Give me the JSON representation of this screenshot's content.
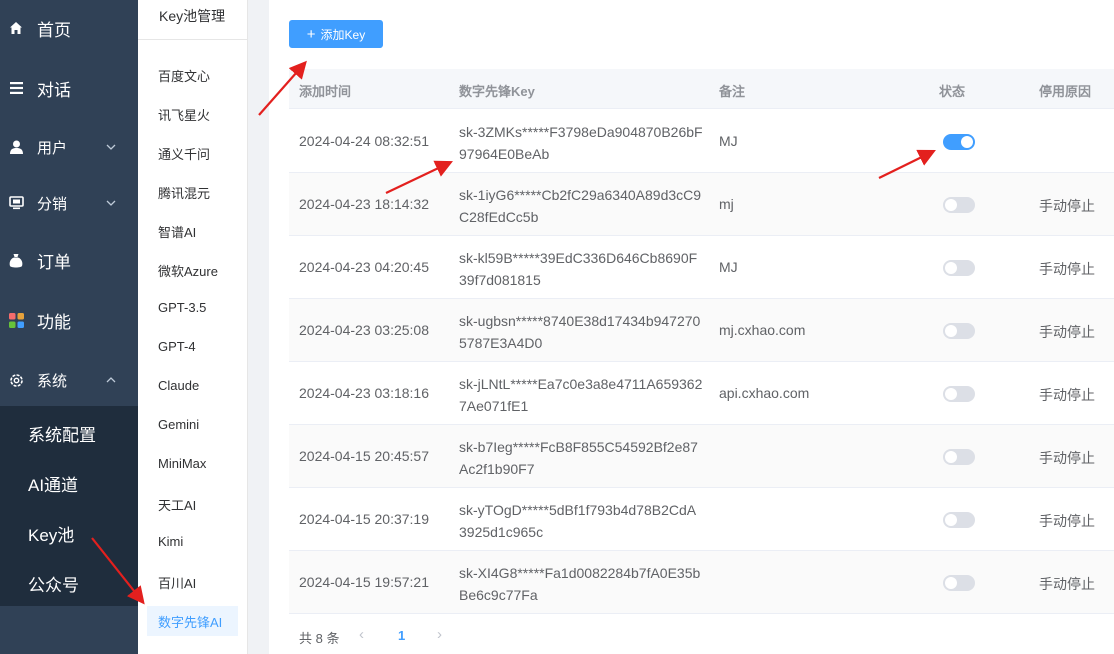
{
  "nav": {
    "items": [
      {
        "label": "首页",
        "icon": "home-icon"
      },
      {
        "label": "对话",
        "icon": "list-icon"
      },
      {
        "label": "用户",
        "icon": "user-icon"
      },
      {
        "label": "分销",
        "icon": "monitor-icon"
      },
      {
        "label": "订单",
        "icon": "money-bag-icon"
      },
      {
        "label": "功能",
        "icon": "grid-icon"
      },
      {
        "label": "系统",
        "icon": "gear-icon"
      }
    ],
    "submenu": [
      "系统配置",
      "AI通道",
      "Key池",
      "公众号"
    ]
  },
  "panel": {
    "title": "Key池管理",
    "items": [
      "百度文心",
      "讯飞星火",
      "通义千问",
      "腾讯混元",
      "智谱AI",
      "微软Azure",
      "GPT-3.5",
      "GPT-4",
      "Claude",
      "Gemini",
      "MiniMax",
      "天工AI",
      "Kimi",
      "百川AI",
      "数字先锋AI"
    ],
    "active": "数字先锋AI"
  },
  "toolbar": {
    "add_label": "添加Key"
  },
  "table": {
    "headers": {
      "time": "添加时间",
      "key": "数字先锋Key",
      "note": "备注",
      "status": "状态",
      "reason": "停用原因"
    },
    "rows": [
      {
        "time": "2024-04-24 08:32:51",
        "key": "sk-3ZMKs*****F3798eDa904870B26bF97964E0BeAb",
        "note": "MJ",
        "enabled": true,
        "reason": ""
      },
      {
        "time": "2024-04-23 18:14:32",
        "key": "sk-1iyG6*****Cb2fC29a6340A89d3cC9C28fEdCc5b",
        "note": "mj",
        "enabled": false,
        "reason": "手动停止"
      },
      {
        "time": "2024-04-23 04:20:45",
        "key": "sk-kl59B*****39EdC336D646Cb8690F39f7d081815",
        "note": "MJ",
        "enabled": false,
        "reason": "手动停止"
      },
      {
        "time": "2024-04-23 03:25:08",
        "key": "sk-ugbsn*****8740E38d17434b9472705787E3A4D0",
        "note": "mj.cxhao.com",
        "enabled": false,
        "reason": "手动停止"
      },
      {
        "time": "2024-04-23 03:18:16",
        "key": "sk-jLNtL*****Ea7c0e3a8e4711A6593627Ae071fE1",
        "note": "api.cxhao.com",
        "enabled": false,
        "reason": "手动停止"
      },
      {
        "time": "2024-04-15 20:45:57",
        "key": "sk-b7Ieg*****FcB8F855C54592Bf2e87Ac2f1b90F7",
        "note": "",
        "enabled": false,
        "reason": "手动停止"
      },
      {
        "time": "2024-04-15 20:37:19",
        "key": "sk-yTOgD*****5dBf1f793b4d78B2CdA3925d1c965c",
        "note": "",
        "enabled": false,
        "reason": "手动停止"
      },
      {
        "time": "2024-04-15 19:57:21",
        "key": "sk-XI4G8*****Fa1d0082284b7fA0E35bBe6c9c77Fa",
        "note": "",
        "enabled": false,
        "reason": "手动停止"
      }
    ]
  },
  "pagination": {
    "total": "共 8 条",
    "page": "1"
  },
  "colors": {
    "accent": "#409eff",
    "nav_bg": "#304156",
    "submenu_bg": "#1f2d3d",
    "annotation": "#e3201e"
  }
}
